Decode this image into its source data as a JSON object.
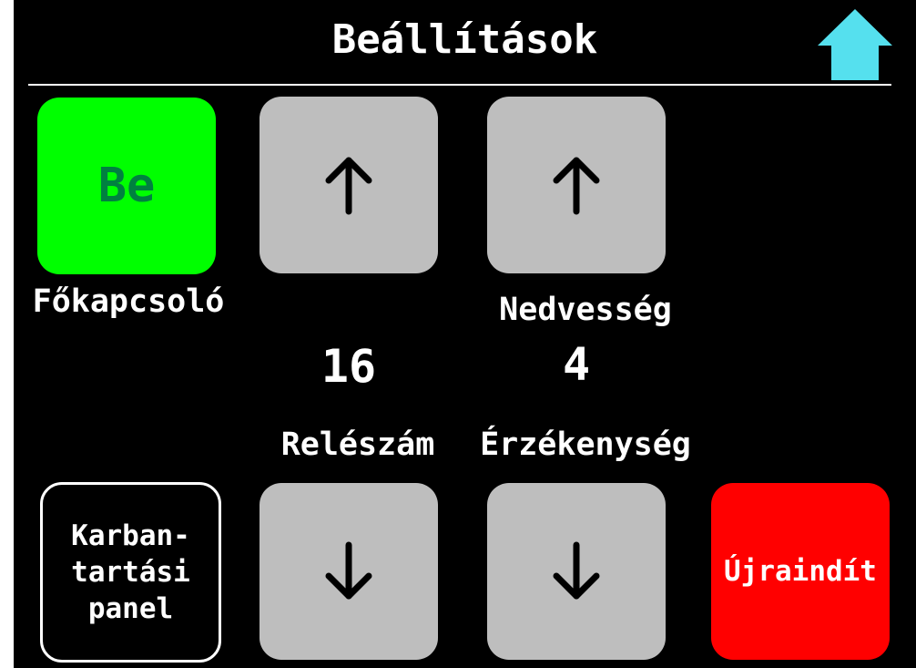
{
  "header": {
    "title": "Beállítások",
    "home_icon": "home-up-arrow-icon",
    "home_color": "#55e0ee"
  },
  "main_switch": {
    "state": "Be",
    "label": "Főkapcsoló",
    "color": "#00ff00",
    "text_color": "#008040"
  },
  "relay": {
    "up_icon": "arrow-up-icon",
    "value": "16",
    "label": "Relészám",
    "down_icon": "arrow-down-icon"
  },
  "humidity": {
    "up_icon": "arrow-up-icon",
    "label_top": "Nedvesség",
    "value": "4",
    "label": "Érzékenység",
    "down_icon": "arrow-down-icon"
  },
  "maintenance": {
    "label": "Karban-\ntartási\npanel"
  },
  "restart": {
    "label": "Újraindít",
    "color": "#ff0000"
  },
  "colors": {
    "background": "#000000",
    "tile_gray": "#bebebe",
    "text": "#ffffff"
  }
}
